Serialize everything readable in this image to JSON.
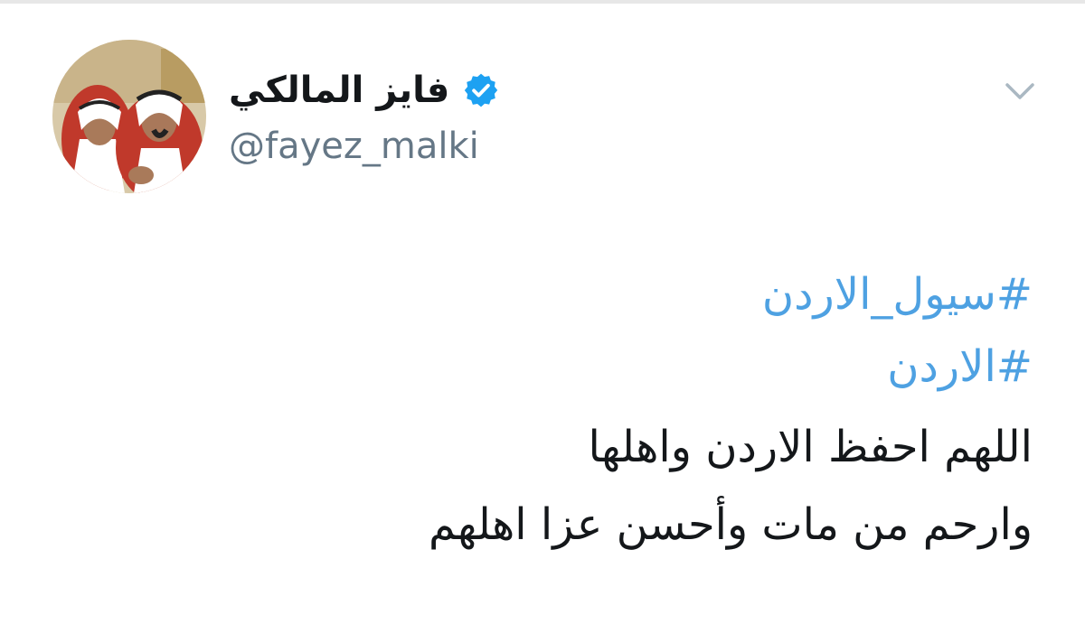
{
  "tweet": {
    "author": {
      "display_name": "فايز المالكي",
      "username": "@fayez_malki",
      "verified": true,
      "avatar_icon": "profile-photo"
    },
    "menu_icon": "chevron-down-icon",
    "hashtags": [
      "#سيول_الاردن",
      "#الاردن"
    ],
    "text_lines": [
      "اللهم احفظ الاردن واهلها",
      "وارحم من مات وأحسن عزا اهلهم"
    ]
  },
  "colors": {
    "hashtag": "#4ea1e2",
    "verified_badge": "#1da1f2",
    "username": "#657786",
    "text": "#14171a",
    "chevron": "#aab8c2"
  }
}
